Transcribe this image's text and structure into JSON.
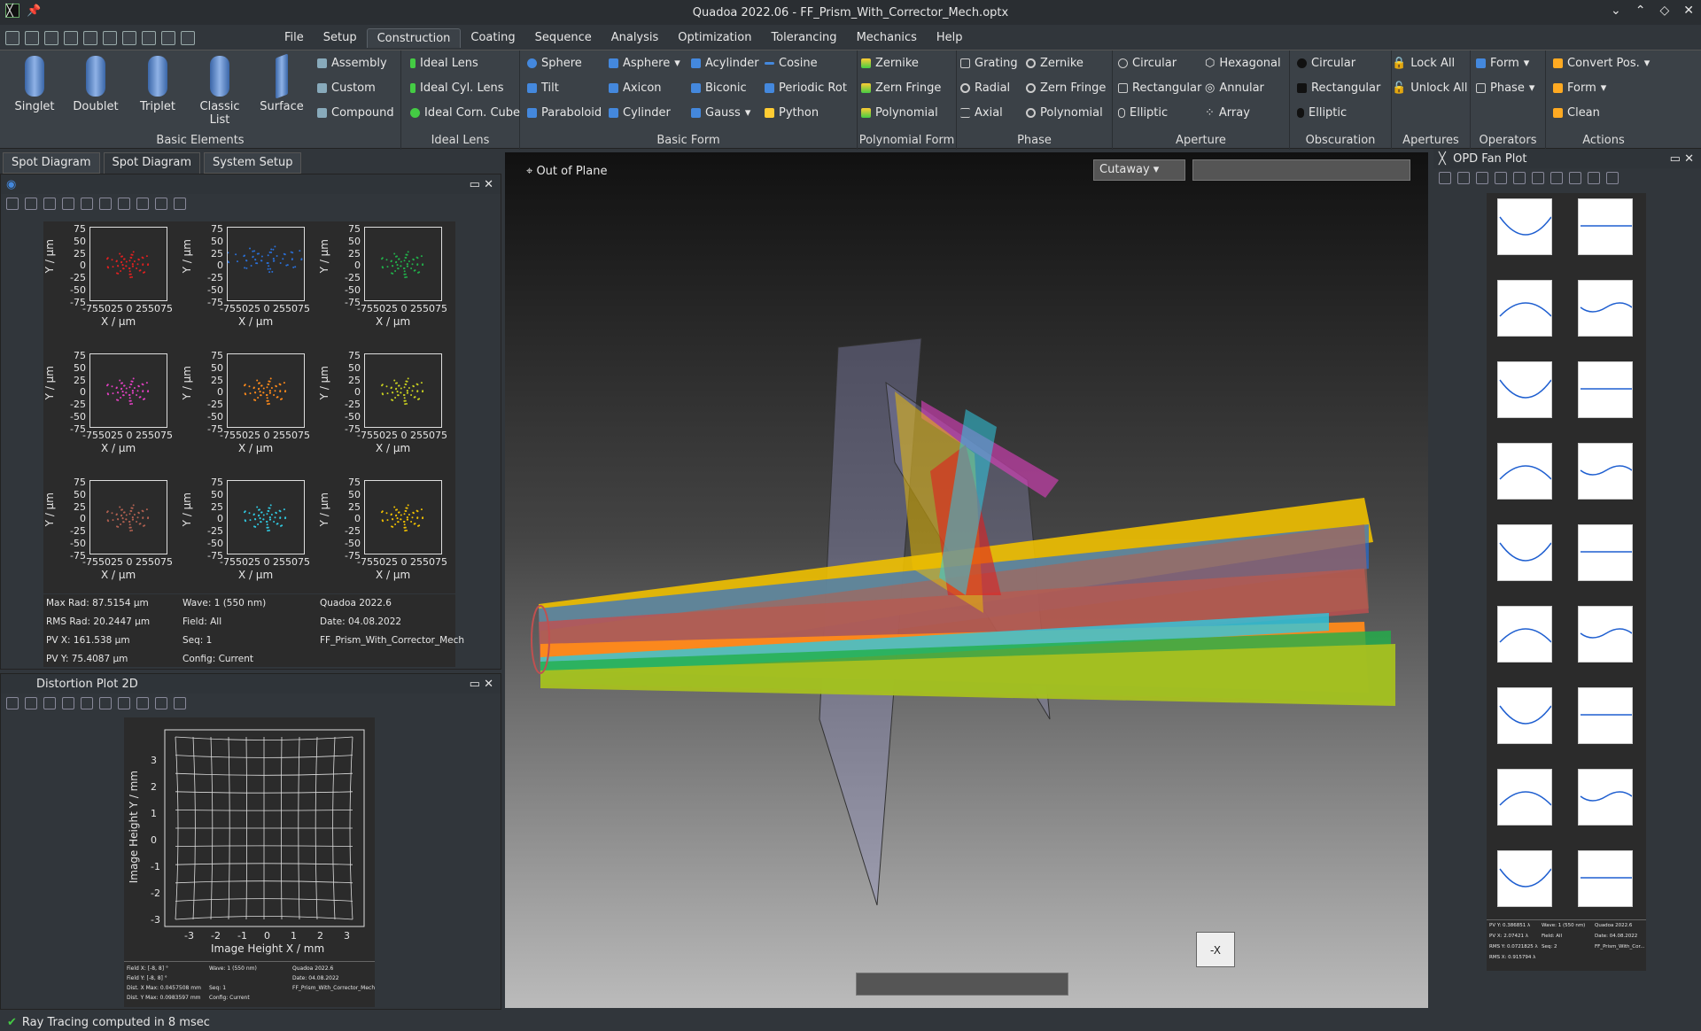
{
  "window": {
    "title": "Quadoa 2022.06 - FF_Prism_With_Corrector_Mech.optx",
    "controls": [
      "⌄",
      "⌃",
      "◇",
      "✕"
    ]
  },
  "menu": [
    "File",
    "Setup",
    "Construction",
    "Coating",
    "Sequence",
    "Analysis",
    "Optimization",
    "Tolerancing",
    "Mechanics",
    "Help"
  ],
  "menu_active": "Construction",
  "ribbon": {
    "basic_elements": {
      "label": "Basic Elements",
      "big": [
        "Singlet",
        "Doublet",
        "Triplet",
        "Classic List",
        "Surface"
      ],
      "small": [
        "Assembly",
        "Custom",
        "Compound"
      ]
    },
    "ideal_lens": {
      "label": "Ideal Lens",
      "items": [
        "Ideal Lens",
        "Ideal Cyl. Lens",
        "Ideal Corn. Cube"
      ]
    },
    "basic_form": {
      "label": "Basic Form",
      "col1": [
        "Sphere",
        "Tilt",
        "Paraboloid"
      ],
      "col2": [
        "Asphere",
        "Axicon",
        "Cylinder"
      ],
      "col3": [
        "Acylinder",
        "Biconic",
        "Gauss"
      ],
      "col4": [
        "Cosine",
        "Periodic Rot",
        "Python"
      ]
    },
    "polynomial_form": {
      "label": "Polynomial Form",
      "items": [
        "Zernike",
        "Zern Fringe",
        "Polynomial"
      ]
    },
    "phase": {
      "label": "Phase",
      "col1": [
        "Grating",
        "Radial",
        "Axial"
      ],
      "col2": [
        "Zernike",
        "Zern Fringe",
        "Polynomial"
      ]
    },
    "aperture": {
      "label": "Aperture",
      "col1": [
        "Circular",
        "Rectangular",
        "Elliptic"
      ],
      "col2": [
        "Hexagonal",
        "Annular",
        "Array"
      ]
    },
    "obscuration": {
      "label": "Obscuration",
      "items": [
        "Circular",
        "Rectangular",
        "Elliptic"
      ]
    },
    "apertures": {
      "label": "Apertures",
      "items": [
        "Lock All",
        "Unlock All"
      ]
    },
    "operators": {
      "label": "Operators",
      "items": [
        "Form",
        "Phase"
      ]
    },
    "actions": {
      "label": "Actions",
      "items": [
        "Convert Pos.",
        "Form",
        "Clean"
      ]
    }
  },
  "tabs": [
    "Spot Diagram",
    "Spot Diagram",
    "System Setup"
  ],
  "spot": {
    "ylabel": "Y / µm",
    "xlabel": "X / µm",
    "yticks": [
      "75",
      "50",
      "25",
      "0",
      "-25",
      "-50",
      "-75"
    ],
    "xticks": "-755025 0 255075",
    "colors": [
      "#e02020",
      "#2a6fd6",
      "#22b04a",
      "#e040c0",
      "#ff8a1a",
      "#c8d020",
      "#b06050",
      "#30c8e0",
      "#f0c000"
    ],
    "info": {
      "max_rad": "Max Rad: 87.5154 µm",
      "rms_rad": "RMS Rad: 20.2447 µm",
      "pv_x": "PV X: 161.538 µm",
      "pv_y": "PV Y: 75.4087 µm",
      "wave": "Wave: 1 (550 nm)",
      "field": "Field: All",
      "seq": "Seq: 1",
      "config": "Config: Current",
      "brand": "Quadoa 2022.6",
      "date": "Date: 04.08.2022",
      "file": "FF_Prism_With_Corrector_Mech"
    }
  },
  "distortion": {
    "title": "Distortion Plot 2D",
    "ylabel": "Image Height Y / mm",
    "xlabel": "Image Height X / mm",
    "ticks": [
      "-3",
      "-2",
      "-1",
      "0",
      "1",
      "2",
      "3"
    ],
    "info": {
      "fx": "Field X: [-8, 8] °",
      "fy": "Field Y: [-8, 8] °",
      "dx": "Dist. X Max: 0.0457508 mm",
      "dy": "Dist. Y Max: 0.0983597 mm",
      "wave": "Wave: 1 (550 nm)",
      "seq": "Seq: 1",
      "config": "Config: Current",
      "brand": "Quadoa 2022.6",
      "date": "Date: 04.08.2022",
      "file": "FF_Prism_With_Corrector_Mech"
    }
  },
  "viewport": {
    "label": "Out of Plane",
    "cutaway": "Cutaway",
    "cube": "-X"
  },
  "opd": {
    "title": "OPD Fan Plot",
    "info": {
      "pvy": "PV Y: 0.386851 λ",
      "pvx": "PV X: 2.07421 λ",
      "rmsy": "RMS Y: 0.0721825 λ",
      "rmsx": "RMS X: 0.915794 λ",
      "wave": "Wave: 1 (550 nm)",
      "field": "Field: All",
      "seq": "Seq: 2",
      "brand": "Quadoa 2022.6",
      "date": "Date: 04.08.2022",
      "file": "FF_Prism_With_Cor..."
    }
  },
  "status": "Ray Tracing computed in 8 msec"
}
